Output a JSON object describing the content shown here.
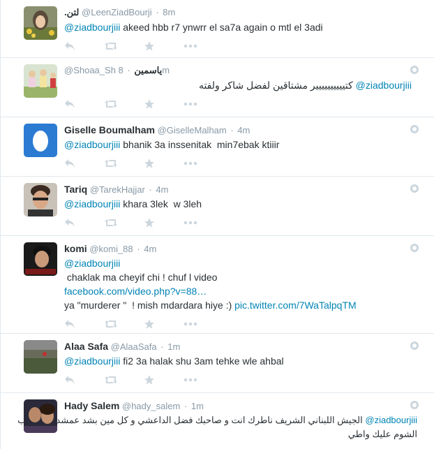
{
  "tweets": [
    {
      "name": "",
      "rtl_name": "لتن.",
      "handle": "@LeenZiadBourji",
      "time": "8m",
      "mention": "@ziadbourjiii",
      "text": "akeed hbb r7 ynwrr el sa7a again o mtl el 3adi"
    },
    {
      "name": "",
      "rtl_name": "ياسمين",
      "handle": "@Shoaa_Sh",
      "time": "8m",
      "mention": "@ziadbourjiii",
      "text": "كتيييييييييير مشتاقين لفضل شاكر ولفته"
    },
    {
      "name": "Giselle Boumalham",
      "handle": "@GiselleMalham",
      "time": "4m",
      "mention": "@ziadbourjiii",
      "text": " bhanik 3a inssenitak  min7ebak ktiiir"
    },
    {
      "name": "Tariq",
      "handle": "@TarekHajjar",
      "time": "4m",
      "mention": "@ziadbourjiii",
      "text": "khara 3lek  w 3leh"
    },
    {
      "name": "komi",
      "handle": "@komi_88",
      "time": "4m",
      "mention": "@ziadbourjiii",
      "line2": " chaklak ma cheyif chi ! chuf l video",
      "link1": "facebook.com/video.php?v=88…",
      "line4": "ya \"murderer \"  ! mish mdardara hiye :) ",
      "link2": "pic.twitter.com/7WaTalpqTM"
    },
    {
      "name": "Alaa Safa",
      "handle": "@AlaaSafa",
      "time": "1m",
      "mention": "@ziadbourjiii",
      "text": "fi2 3a halak shu 3am tehke wle ahbal"
    },
    {
      "name": "Hady Salem",
      "handle": "@hady_salem",
      "time": "1m",
      "mention": "@ziadbourjiii",
      "text_line1": "الجيش اللبناني الشريف ناطرك انت و صاحبك فضل الداعشي و كل مين بشد عمشدكن يا عيب",
      "text_line2": "الشوم عليك واطي"
    }
  ],
  "separator": "·",
  "colors": {
    "link": "#0084b4",
    "meta": "#8899a6",
    "icon": "#ccd6dd",
    "border": "#e1e8ed"
  },
  "icons": [
    "reply-icon",
    "retweet-icon",
    "favorite-icon",
    "more-icon",
    "gear-icon"
  ]
}
